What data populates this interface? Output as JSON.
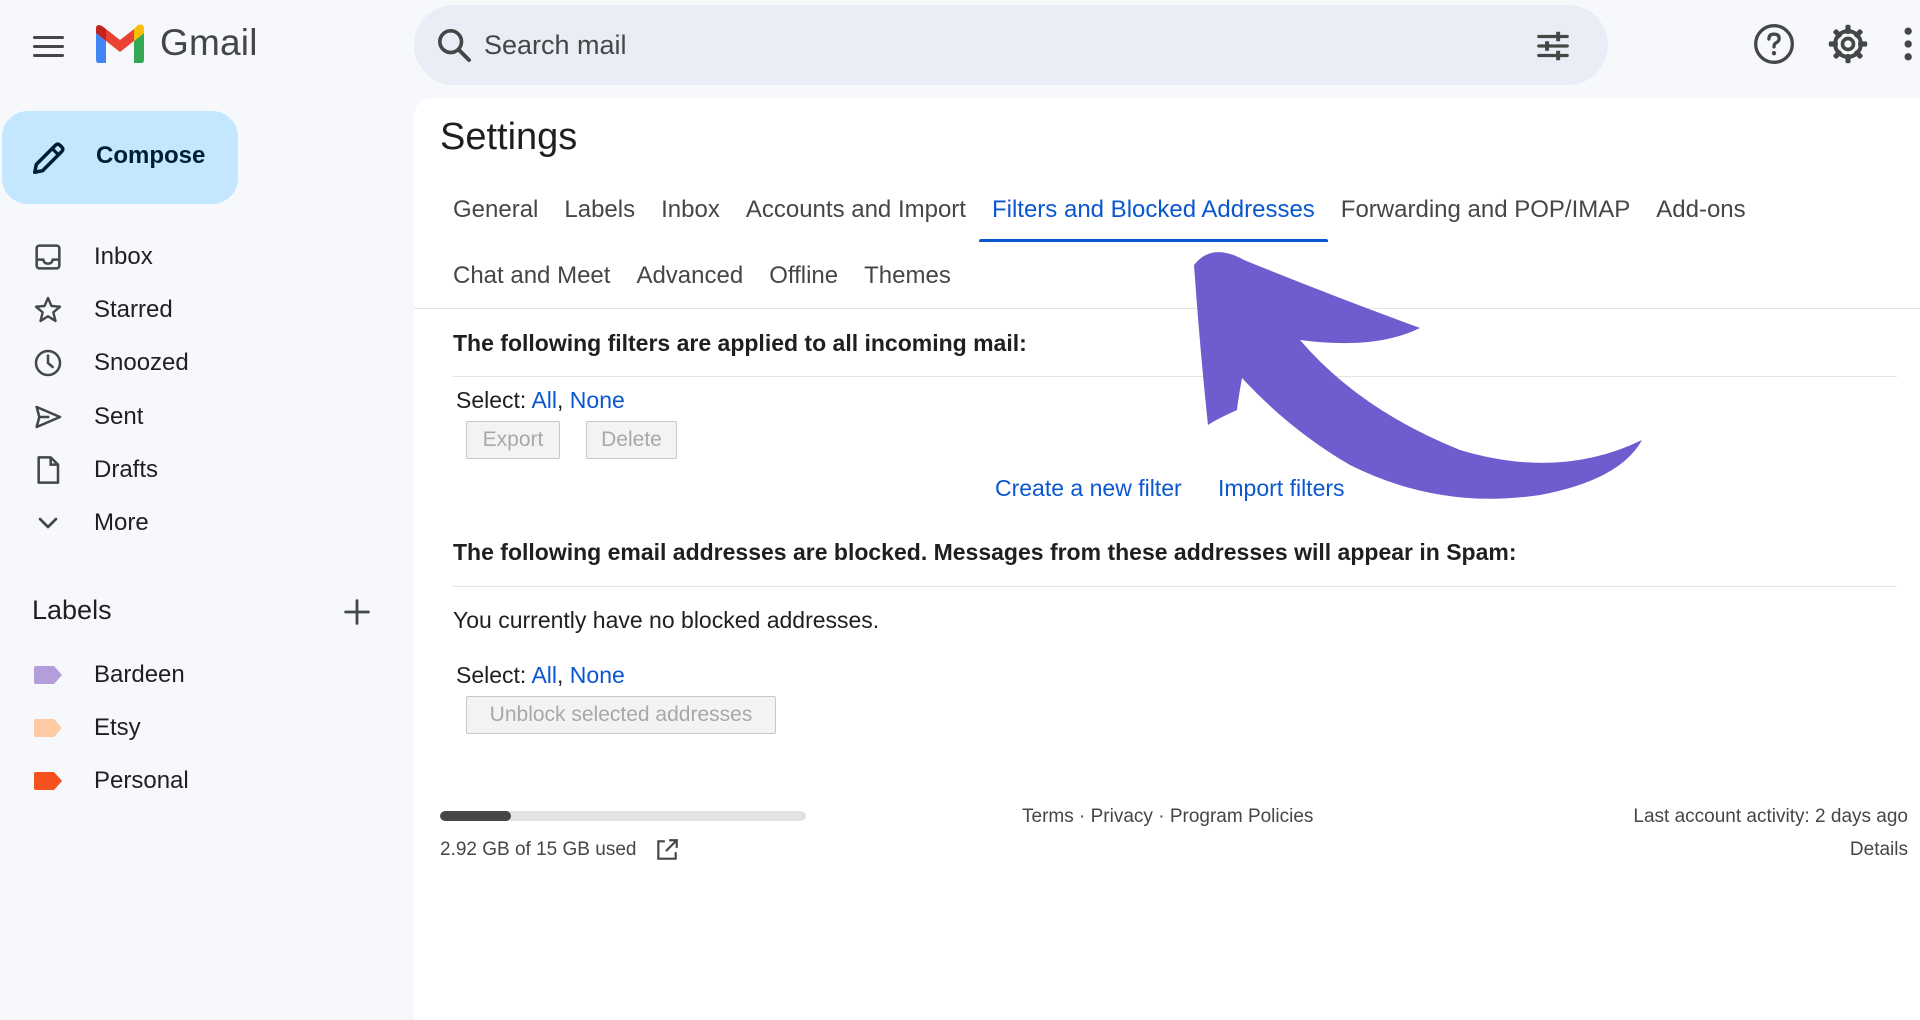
{
  "app": {
    "name": "Gmail",
    "brand_colors": {
      "red": "#ea4335",
      "blue": "#4285f4",
      "green": "#34a853",
      "yellow": "#fbbc04"
    }
  },
  "search": {
    "placeholder": "Search mail"
  },
  "sidebar": {
    "compose_label": "Compose",
    "items": [
      {
        "label": "Inbox",
        "icon": "inbox-icon"
      },
      {
        "label": "Starred",
        "icon": "star-icon"
      },
      {
        "label": "Snoozed",
        "icon": "clock-icon"
      },
      {
        "label": "Sent",
        "icon": "send-icon"
      },
      {
        "label": "Drafts",
        "icon": "draft-icon"
      },
      {
        "label": "More",
        "icon": "chevron-down-icon"
      }
    ],
    "labels_title": "Labels",
    "labels": [
      {
        "name": "Bardeen",
        "color": "#b39ddb"
      },
      {
        "name": "Etsy",
        "color": "#ffcba4"
      },
      {
        "name": "Personal",
        "color": "#f4511e"
      }
    ]
  },
  "settings": {
    "title": "Settings",
    "tabs_row1": [
      {
        "label": "General",
        "active": false
      },
      {
        "label": "Labels",
        "active": false
      },
      {
        "label": "Inbox",
        "active": false
      },
      {
        "label": "Accounts and Import",
        "active": false
      },
      {
        "label": "Filters and Blocked Addresses",
        "active": true
      },
      {
        "label": "Forwarding and POP/IMAP",
        "active": false
      },
      {
        "label": "Add-ons",
        "active": false
      }
    ],
    "tabs_row2": [
      {
        "label": "Chat and Meet",
        "active": false
      },
      {
        "label": "Advanced",
        "active": false
      },
      {
        "label": "Offline",
        "active": false
      },
      {
        "label": "Themes",
        "active": false
      }
    ],
    "filters": {
      "heading": "The following filters are applied to all incoming mail:",
      "select_label": "Select:",
      "select_all": "All",
      "select_none": "None",
      "export_label": "Export",
      "delete_label": "Delete",
      "create_filter": "Create a new filter",
      "import_filters": "Import filters"
    },
    "blocked": {
      "heading": "The following email addresses are blocked. Messages from these addresses will appear in Spam:",
      "empty_message": "You currently have no blocked addresses.",
      "select_label": "Select:",
      "select_all": "All",
      "select_none": "None",
      "unblock_label": "Unblock selected addresses"
    }
  },
  "footer": {
    "storage_text": "2.92 GB of 15 GB used",
    "storage_fraction": 0.195,
    "terms": "Terms",
    "privacy": "Privacy",
    "policies": "Program Policies",
    "separator": " · ",
    "activity": "Last account activity: 2 days ago",
    "details": "Details"
  },
  "annotation": {
    "arrow_color": "#6f5ccf"
  }
}
